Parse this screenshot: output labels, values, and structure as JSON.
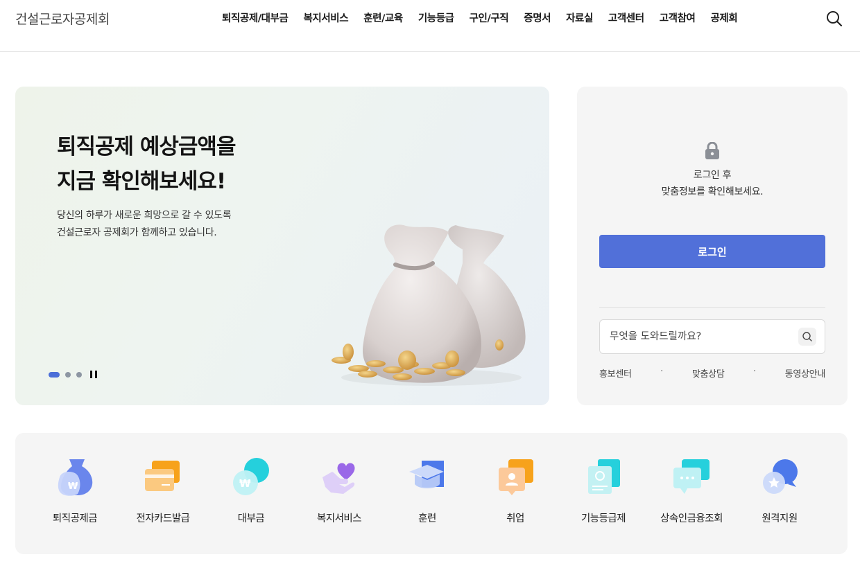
{
  "header": {
    "logo": "건설근로자공제회",
    "nav": [
      "퇴직공제/대부금",
      "복지서비스",
      "훈련/교육",
      "기능등급",
      "구인/구직",
      "증명서",
      "자료실",
      "고객센터",
      "고객참여",
      "공제회"
    ],
    "search_icon": "search-icon"
  },
  "hero": {
    "title_line1": "퇴직공제 예상금액을",
    "title_line2": "지금 확인해보세요!",
    "sub_line1": "당신의 하루가 새로운 희망으로 갈 수 있도록",
    "sub_line2": "건설근로자 공제회가 함께하고 있습니다.",
    "slides_total": 3,
    "slide_active": 1
  },
  "login": {
    "msg_line1": "로그인 후",
    "msg_line2": "맞춤정보를 확인해보세요.",
    "button": "로그인",
    "search_placeholder": "무엇을 도와드릴까요?",
    "links": [
      "홍보센터",
      "맞춤상담",
      "동영상안내"
    ],
    "link_sep": "·"
  },
  "services": [
    {
      "label": "퇴직공제금",
      "icon": "money-bag-icon"
    },
    {
      "label": "전자카드발급",
      "icon": "card-icon"
    },
    {
      "label": "대부금",
      "icon": "loan-coin-icon"
    },
    {
      "label": "복지서비스",
      "icon": "heart-hand-icon"
    },
    {
      "label": "훈련",
      "icon": "graduation-cap-icon"
    },
    {
      "label": "취업",
      "icon": "id-badge-icon"
    },
    {
      "label": "기능등급제",
      "icon": "certificate-icon"
    },
    {
      "label": "상속인금융조회",
      "icon": "chat-dots-icon"
    },
    {
      "label": "원격지원",
      "icon": "star-chat-icon"
    }
  ],
  "colors": {
    "accent": "#5170d9",
    "dot_active": "#4b6ed8",
    "card_bg": "#f5f5f5"
  }
}
